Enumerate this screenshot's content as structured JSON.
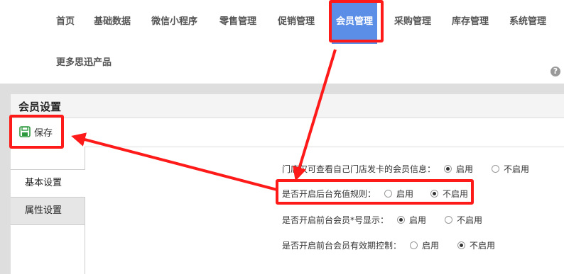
{
  "nav": {
    "items": [
      {
        "label": "首页"
      },
      {
        "label": "基础数据"
      },
      {
        "label": "微信小程序"
      },
      {
        "label": "零售管理"
      },
      {
        "label": "促销管理"
      },
      {
        "label": "会员管理"
      },
      {
        "label": "采购管理"
      },
      {
        "label": "库存管理"
      },
      {
        "label": "系统管理"
      },
      {
        "label": "更多思迅产品"
      }
    ],
    "active": "会员管理"
  },
  "help_icon": "help-circle-icon",
  "panel": {
    "title": "会员设置",
    "save_label": "保存",
    "save_icon": "save-icon"
  },
  "sidebar": {
    "items": [
      {
        "label": "基本设置"
      },
      {
        "label": "属性设置"
      }
    ]
  },
  "settings": [
    {
      "label": "门店仅可查看自己门店发卡的会员信息：",
      "options": [
        "启用",
        "不启用"
      ],
      "selected": "启用"
    },
    {
      "label": "是否开启后台充值规则：",
      "options": [
        "启用",
        "不启用"
      ],
      "selected": "不启用"
    },
    {
      "label": "是否开启前台会员*号显示：",
      "options": [
        "启用",
        "不启用"
      ],
      "selected": "启用"
    },
    {
      "label": "是否开启前台会员有效期控制：",
      "options": [
        "启用",
        "不启用"
      ],
      "selected": "不启用"
    }
  ],
  "colors": {
    "highlight": "#ff1a1a",
    "nav_active": "#5b8ee6",
    "save_icon": "#2e9a3e"
  }
}
